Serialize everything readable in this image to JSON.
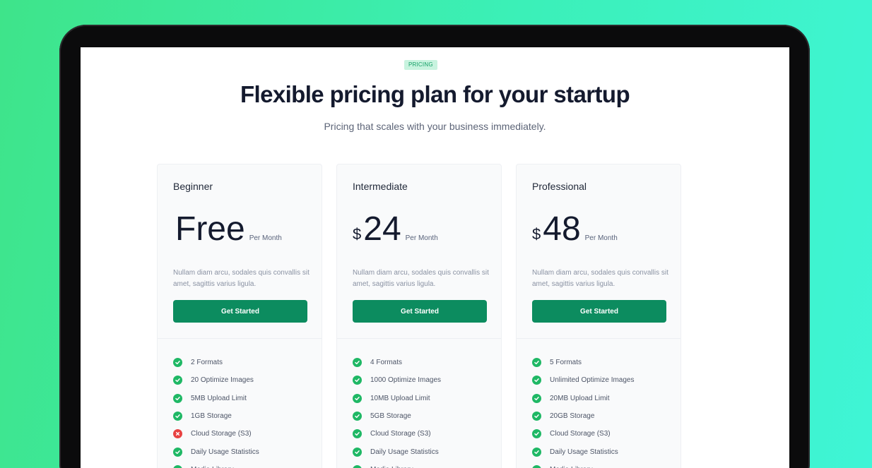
{
  "header": {
    "badge": "PRICING",
    "title": "Flexible pricing plan for your startup",
    "subtitle": "Pricing that scales with your business immediately."
  },
  "colors": {
    "accent": "#0c8c5f",
    "check": "#1fb865",
    "cross": "#e84242",
    "badge_bg": "#c8f3df"
  },
  "plans": [
    {
      "name": "Beginner",
      "currency": "",
      "amount": "Free",
      "period": "Per Month",
      "description": "Nullam diam arcu, sodales quis convallis sit amet, sagittis varius ligula.",
      "cta": "Get Started",
      "features": [
        {
          "label": "2 Formats",
          "included": true
        },
        {
          "label": "20 Optimize Images",
          "included": true
        },
        {
          "label": "5MB Upload Limit",
          "included": true
        },
        {
          "label": "1GB Storage",
          "included": true
        },
        {
          "label": "Cloud Storage (S3)",
          "included": false
        },
        {
          "label": "Daily Usage Statistics",
          "included": true
        },
        {
          "label": "Media Library",
          "included": true
        }
      ]
    },
    {
      "name": "Intermediate",
      "currency": "$",
      "amount": "24",
      "period": "Per Month",
      "description": "Nullam diam arcu, sodales quis convallis sit amet, sagittis varius ligula.",
      "cta": "Get Started",
      "features": [
        {
          "label": "4 Formats",
          "included": true
        },
        {
          "label": "1000 Optimize Images",
          "included": true
        },
        {
          "label": "10MB Upload Limit",
          "included": true
        },
        {
          "label": "5GB Storage",
          "included": true
        },
        {
          "label": "Cloud Storage (S3)",
          "included": true
        },
        {
          "label": "Daily Usage Statistics",
          "included": true
        },
        {
          "label": "Media Library",
          "included": true
        }
      ]
    },
    {
      "name": "Professional",
      "currency": "$",
      "amount": "48",
      "period": "Per Month",
      "description": "Nullam diam arcu, sodales quis convallis sit amet, sagittis varius ligula.",
      "cta": "Get Started",
      "features": [
        {
          "label": "5 Formats",
          "included": true
        },
        {
          "label": "Unlimited Optimize Images",
          "included": true
        },
        {
          "label": "20MB Upload Limit",
          "included": true
        },
        {
          "label": "20GB Storage",
          "included": true
        },
        {
          "label": "Cloud Storage (S3)",
          "included": true
        },
        {
          "label": "Daily Usage Statistics",
          "included": true
        },
        {
          "label": "Media Library",
          "included": true
        }
      ]
    }
  ]
}
